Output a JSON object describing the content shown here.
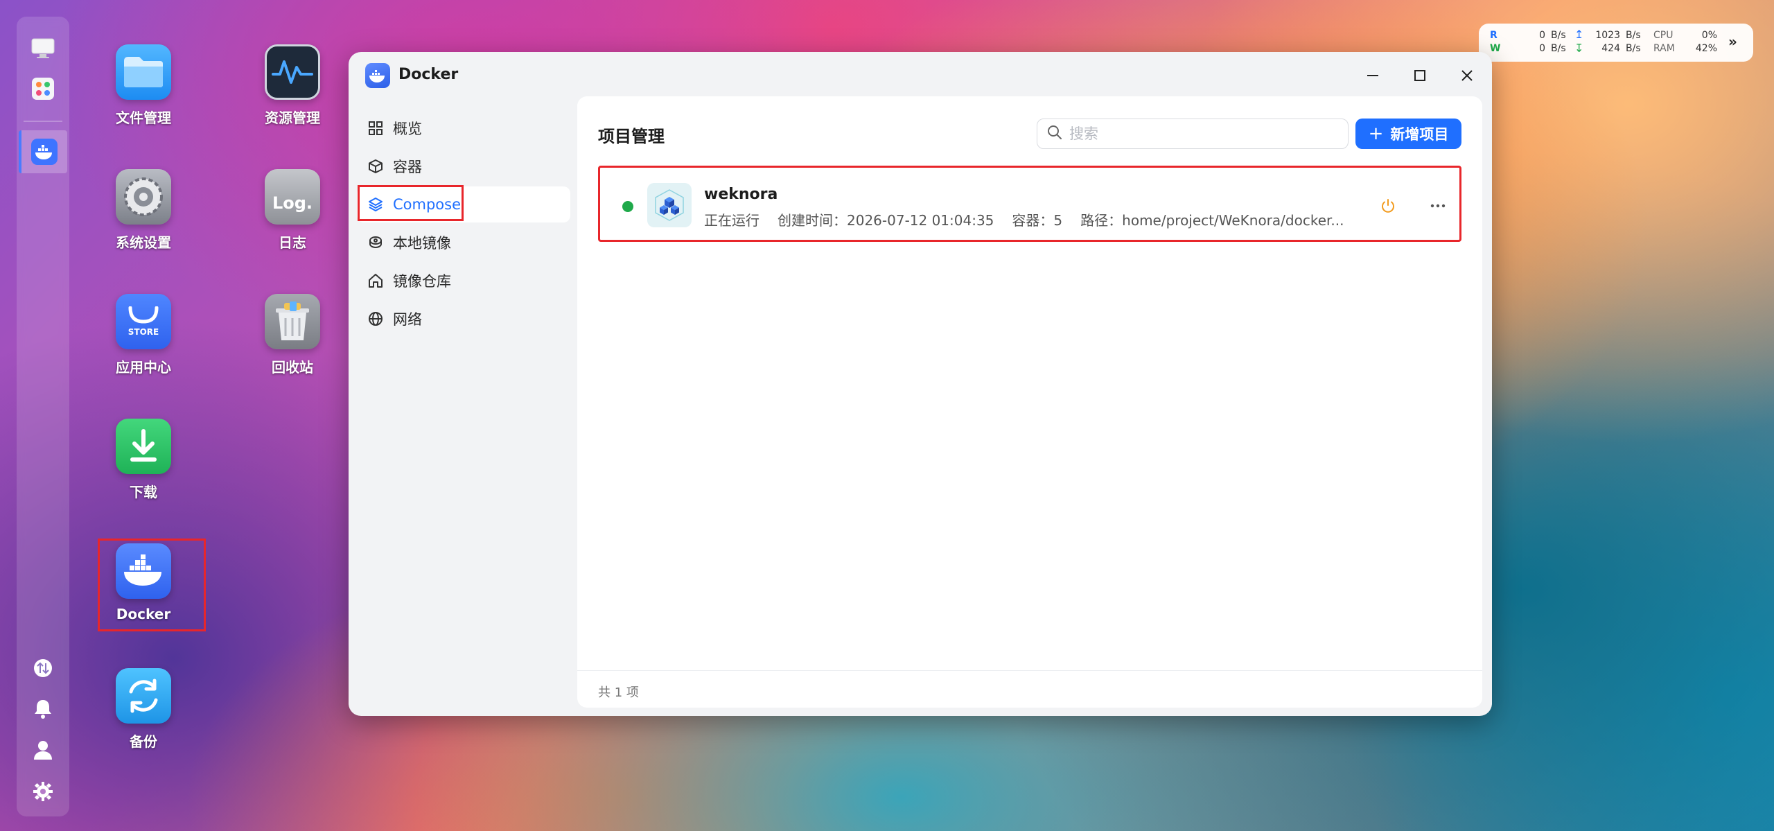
{
  "status": {
    "r_label": "R",
    "w_label": "W",
    "r_val": "0",
    "w_val": "0",
    "bs": "B/s",
    "up_val": "1023",
    "down_val": "424",
    "cpu_label": "CPU",
    "ram_label": "RAM",
    "cpu_val": "0%",
    "ram_val": "42%",
    "accent_r": "#1f6fff",
    "accent_w": "#1fa94a"
  },
  "desktop": {
    "icons": [
      {
        "label": "文件管理",
        "icon": "folder-icon"
      },
      {
        "label": "资源管理",
        "icon": "activity-monitor-icon"
      },
      {
        "label": "系统设置",
        "icon": "settings-gear-icon"
      },
      {
        "label": "日志",
        "icon": "log-icon",
        "glyph": "Log."
      },
      {
        "label": "应用中心",
        "icon": "app-store-icon",
        "glyph": "STORE"
      },
      {
        "label": "回收站",
        "icon": "trash-icon"
      },
      {
        "label": "下载",
        "icon": "download-icon"
      },
      {
        "label": "Docker",
        "icon": "docker-icon"
      },
      {
        "label": "备份",
        "icon": "backup-icon"
      }
    ]
  },
  "window": {
    "title": "Docker",
    "nav": [
      {
        "label": "概览",
        "icon": "grid-icon"
      },
      {
        "label": "容器",
        "icon": "cube-icon"
      },
      {
        "label": "Compose",
        "icon": "layers-icon"
      },
      {
        "label": "本地镜像",
        "icon": "disk-icon"
      },
      {
        "label": "镜像仓库",
        "icon": "house-icon"
      },
      {
        "label": "网络",
        "icon": "globe-icon"
      }
    ],
    "page_title": "项目管理",
    "search_placeholder": "搜索",
    "add_label": "新增项目",
    "project": {
      "name": "weknora",
      "status": "正在运行",
      "created": "创建时间：2026-07-12 01:04:35",
      "containers": "容器：5",
      "path": "路径：home/project/WeKnora/docker..."
    },
    "footer": "共 1 项",
    "accent": "#1f6fff"
  }
}
